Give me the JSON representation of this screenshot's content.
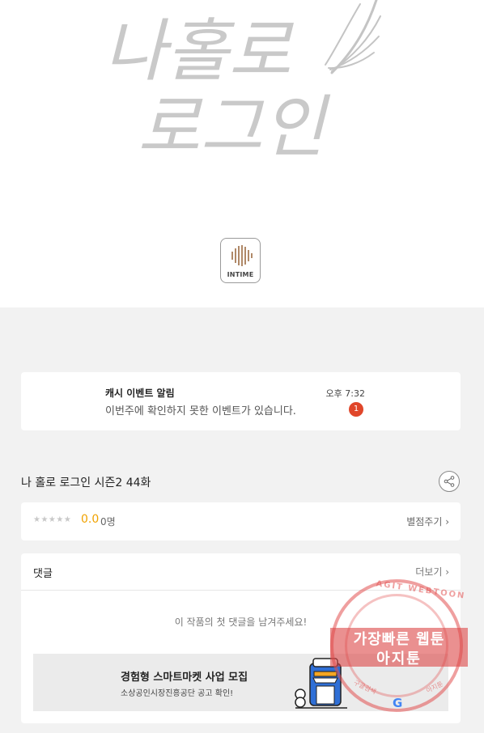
{
  "hero": {
    "title_line1": "나홀로",
    "title_line2": "로그인",
    "publisher": "INTIME"
  },
  "notification": {
    "title": "캐시 이벤트 알림",
    "body": "이번주에 확인하지 못한 이벤트가 있습니다.",
    "time": "오후 7:32",
    "badge": "1"
  },
  "episode": {
    "title": "나 홀로 로그인 시즌2 44화"
  },
  "rating": {
    "stars": "★★★★★",
    "score": "0.0",
    "count": "0명",
    "rate_link": "별점주기 ›"
  },
  "comments": {
    "title": "댓글",
    "more": "더보기 ›",
    "empty": "이 작품의 첫 댓글을 남겨주세요!"
  },
  "ad": {
    "title": "경험형 스마트마켓 사업 모집",
    "subtitle": "소상공인시장진흥공단 공고 확인!"
  },
  "watermark": {
    "arc": "AGIT WEBTOON",
    "main": "가장빠른 웹툰",
    "sub": "아지툰",
    "left": "구글검색",
    "right": "아지툰",
    "g": "G"
  },
  "colors": {
    "accent_score": "#f0a200",
    "badge": "#e0462a",
    "page_bg": "#f2f2f2"
  }
}
